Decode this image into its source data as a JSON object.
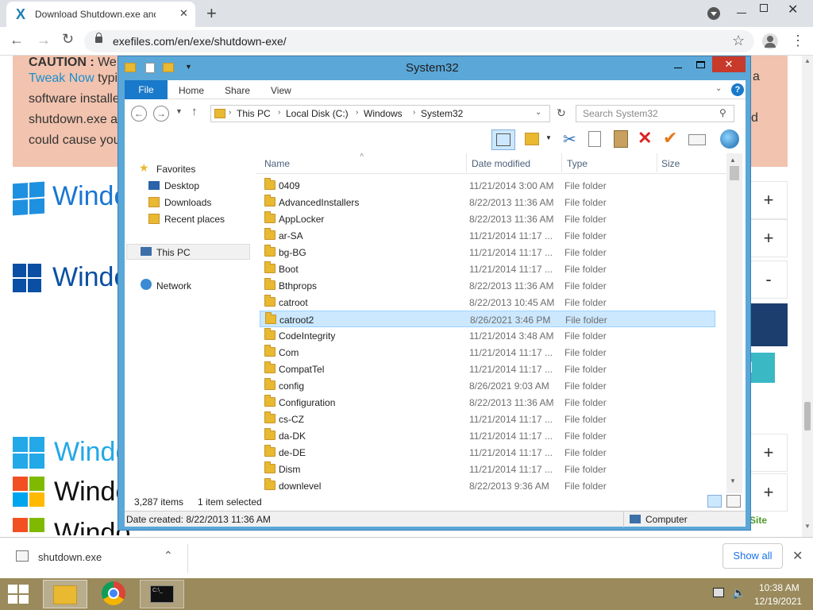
{
  "browser": {
    "tab_title": "Download Shutdown.exe and Tro",
    "url": "exefiles.com/en/exe/shutdown-exe/",
    "new_tab_symbol": "+",
    "close_tab_symbol": "✕",
    "menu_symbol": "⋮",
    "star_symbol": "☆"
  },
  "webpage": {
    "caution_lines": [
      {
        "parts": [
          {
            "text": "CAUTION :",
            "bold": true
          },
          {
            "text": " We s",
            "bold": false
          }
        ]
      },
      {
        "parts": [
          {
            "text": "Tweak Now",
            "link": true
          },
          {
            "text": " typi",
            "bold": false
          }
        ]
      },
      {
        "parts": [
          {
            "text": "software installe",
            "bold": false
          }
        ]
      },
      {
        "parts": [
          {
            "text": "shutdown.exe a",
            "bold": false
          }
        ]
      },
      {
        "parts": [
          {
            "text": "could cause you",
            "bold": false
          }
        ]
      }
    ],
    "right_fragment_a": "a",
    "right_fragment_d": "d",
    "windows_labels": [
      "Windo",
      "Windo",
      "Windo",
      "Windo",
      "Windo"
    ],
    "plus_buttons": [
      "+",
      "+",
      "-",
      "+",
      "+"
    ],
    "download_button_text": "d",
    "badge_text": "edSite"
  },
  "explorer": {
    "title": "System32",
    "ribbon_tabs": [
      "File",
      "Home",
      "Share",
      "View"
    ],
    "breadcrumb": [
      "This PC",
      "Local Disk (C:)",
      "Windows",
      "System32"
    ],
    "search_placeholder": "Search System32",
    "columns": {
      "name": "Name",
      "date": "Date modified",
      "type": "Type",
      "size": "Size"
    },
    "nav": {
      "favorites": "Favorites",
      "desktop": "Desktop",
      "downloads": "Downloads",
      "recent": "Recent places",
      "this_pc": "This PC",
      "network": "Network"
    },
    "files": [
      {
        "name": "0409",
        "date": "11/21/2014 3:00 AM",
        "type": "File folder"
      },
      {
        "name": "AdvancedInstallers",
        "date": "8/22/2013 11:36 AM",
        "type": "File folder"
      },
      {
        "name": "AppLocker",
        "date": "8/22/2013 11:36 AM",
        "type": "File folder"
      },
      {
        "name": "ar-SA",
        "date": "11/21/2014 11:17 ...",
        "type": "File folder"
      },
      {
        "name": "bg-BG",
        "date": "11/21/2014 11:17 ...",
        "type": "File folder"
      },
      {
        "name": "Boot",
        "date": "11/21/2014 11:17 ...",
        "type": "File folder"
      },
      {
        "name": "Bthprops",
        "date": "8/22/2013 11:36 AM",
        "type": "File folder"
      },
      {
        "name": "catroot",
        "date": "8/22/2013 10:45 AM",
        "type": "File folder"
      },
      {
        "name": "catroot2",
        "date": "8/26/2021 3:46 PM",
        "type": "File folder",
        "selected": true
      },
      {
        "name": "CodeIntegrity",
        "date": "11/21/2014 3:48 AM",
        "type": "File folder"
      },
      {
        "name": "Com",
        "date": "11/21/2014 11:17 ...",
        "type": "File folder"
      },
      {
        "name": "CompatTel",
        "date": "11/21/2014 11:17 ...",
        "type": "File folder"
      },
      {
        "name": "config",
        "date": "8/26/2021 9:03 AM",
        "type": "File folder"
      },
      {
        "name": "Configuration",
        "date": "8/22/2013 11:36 AM",
        "type": "File folder"
      },
      {
        "name": "cs-CZ",
        "date": "11/21/2014 11:17 ...",
        "type": "File folder"
      },
      {
        "name": "da-DK",
        "date": "11/21/2014 11:17 ...",
        "type": "File folder"
      },
      {
        "name": "de-DE",
        "date": "11/21/2014 11:17 ...",
        "type": "File folder"
      },
      {
        "name": "Dism",
        "date": "11/21/2014 11:17 ...",
        "type": "File folder"
      },
      {
        "name": "downlevel",
        "date": "8/22/2013 9:36 AM",
        "type": "File folder"
      }
    ],
    "status_items": "3,287 items",
    "status_selected": "1 item selected",
    "details_date": "Date created: 8/22/2013 11:36 AM",
    "details_location": "Computer"
  },
  "download_bar": {
    "filename": "shutdown.exe",
    "show_all": "Show all"
  },
  "taskbar": {
    "time": "10:38 AM",
    "date": "12/19/2021"
  }
}
